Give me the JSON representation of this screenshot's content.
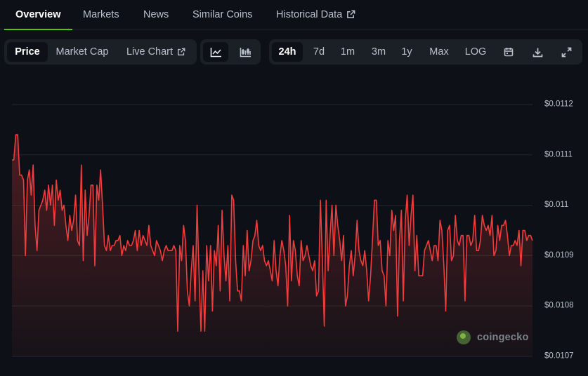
{
  "tabs": [
    {
      "label": "Overview",
      "active": true
    },
    {
      "label": "Markets"
    },
    {
      "label": "News"
    },
    {
      "label": "Similar Coins"
    },
    {
      "label": "Historical Data",
      "icon": "external-link-icon"
    }
  ],
  "metric_toggle": [
    {
      "label": "Price",
      "active": true
    },
    {
      "label": "Market Cap"
    },
    {
      "label": "Live Chart",
      "icon": "external-link-icon"
    }
  ],
  "chart_style": [
    {
      "icon": "line-chart-icon",
      "active": true
    },
    {
      "icon": "candlestick-chart-icon"
    }
  ],
  "ranges": [
    {
      "label": "24h",
      "active": true
    },
    {
      "label": "7d"
    },
    {
      "label": "1m"
    },
    {
      "label": "3m"
    },
    {
      "label": "1y"
    },
    {
      "label": "Max"
    },
    {
      "label": "LOG"
    }
  ],
  "tools": [
    "calendar-icon",
    "download-icon",
    "expand-icon"
  ],
  "watermark": "coingecko",
  "colors": {
    "line": "#f23c3c",
    "accent": "#4bcc00",
    "background": "#0d1117"
  },
  "chart_data": {
    "type": "area",
    "title": "",
    "xlabel": "",
    "ylabel": "",
    "ylim": [
      0.0107,
      0.0112
    ],
    "yticks": [
      {
        "value": 0.0112,
        "label": "$0.0112"
      },
      {
        "value": 0.0111,
        "label": "$0.0111"
      },
      {
        "value": 0.011,
        "label": "$0.011"
      },
      {
        "value": 0.0109,
        "label": "$0.0109"
      },
      {
        "value": 0.0108,
        "label": "$0.0108"
      },
      {
        "value": 0.0107,
        "label": "$0.0107"
      }
    ],
    "series": [
      {
        "values": [
          0.01109,
          0.01109,
          0.01114,
          0.01114,
          0.01106,
          0.01106,
          0.01105,
          0.0109,
          0.01105,
          0.01107,
          0.01102,
          0.01108,
          0.01096,
          0.01091,
          0.01099,
          0.011,
          0.01101,
          0.01103,
          0.01099,
          0.01104,
          0.011,
          0.01104,
          0.01096,
          0.01105,
          0.01101,
          0.01103,
          0.01099,
          0.011,
          0.01096,
          0.01093,
          0.01098,
          0.01095,
          0.01097,
          0.01102,
          0.01093,
          0.01092,
          0.01108,
          0.01089,
          0.01103,
          0.01094,
          0.01098,
          0.01104,
          0.01104,
          0.01088,
          0.01104,
          0.01101,
          0.01107,
          0.011,
          0.01092,
          0.01091,
          0.01094,
          0.01091,
          0.01092,
          0.01092,
          0.01093,
          0.01093,
          0.01094,
          0.0109,
          0.01092,
          0.01091,
          0.01093,
          0.01092,
          0.01092,
          0.01093,
          0.01095,
          0.01091,
          0.01095,
          0.01092,
          0.01094,
          0.01093,
          0.01092,
          0.01096,
          0.01092,
          0.01091,
          0.0109,
          0.01093,
          0.01092,
          0.01091,
          0.01089,
          0.01091,
          0.01092,
          0.01091,
          0.01091,
          0.01091,
          0.01092,
          0.01091,
          0.01075,
          0.01092,
          0.01089,
          0.01096,
          0.01093,
          0.01083,
          0.0108,
          0.01087,
          0.01092,
          0.01081,
          0.011,
          0.01087,
          0.01075,
          0.01087,
          0.01075,
          0.01092,
          0.01085,
          0.01092,
          0.01079,
          0.01091,
          0.01088,
          0.01096,
          0.01083,
          0.01099,
          0.0109,
          0.01085,
          0.01092,
          0.01081,
          0.01102,
          0.01101,
          0.01089,
          0.01083,
          0.01083,
          0.01081,
          0.01092,
          0.01086,
          0.01095,
          0.01087,
          0.01089,
          0.01093,
          0.01094,
          0.01097,
          0.01092,
          0.01091,
          0.01092,
          0.01089,
          0.01088,
          0.01089,
          0.01087,
          0.01085,
          0.01093,
          0.01087,
          0.01084,
          0.0109,
          0.01093,
          0.01091,
          0.01088,
          0.0108,
          0.01098,
          0.01085,
          0.01093,
          0.01091,
          0.01086,
          0.01084,
          0.01093,
          0.01089,
          0.0109,
          0.01092,
          0.0109,
          0.01088,
          0.01087,
          0.01089,
          0.01082,
          0.01083,
          0.01101,
          0.01089,
          0.01076,
          0.01101,
          0.01087,
          0.01094,
          0.011,
          0.0109,
          0.011,
          0.01096,
          0.01093,
          0.01089,
          0.01094,
          0.0108,
          0.01082,
          0.01088,
          0.01091,
          0.01086,
          0.0109,
          0.01097,
          0.01091,
          0.01089,
          0.01088,
          0.01091,
          0.01087,
          0.01081,
          0.01086,
          0.01093,
          0.01101,
          0.01101,
          0.01092,
          0.01093,
          0.01087,
          0.01086,
          0.0108,
          0.01093,
          0.0109,
          0.01099,
          0.01095,
          0.01098,
          0.01078,
          0.01093,
          0.01099,
          0.01081,
          0.01097,
          0.01102,
          0.01092,
          0.01098,
          0.01102,
          0.01087,
          0.01094,
          0.01086,
          0.01086,
          0.01086,
          0.01091,
          0.01092,
          0.01093,
          0.01091,
          0.01089,
          0.01092,
          0.01092,
          0.01089,
          0.01097,
          0.01095,
          0.01088,
          0.01079,
          0.01095,
          0.01096,
          0.01089,
          0.0109,
          0.01098,
          0.01093,
          0.01092,
          0.01094,
          0.01094,
          0.01081,
          0.01094,
          0.01094,
          0.01092,
          0.01093,
          0.01098,
          0.01091,
          0.01091,
          0.01093,
          0.01098,
          0.01096,
          0.01095,
          0.01096,
          0.01094,
          0.01098,
          0.0109,
          0.01091,
          0.01096,
          0.01093,
          0.01096,
          0.01096,
          0.01097,
          0.01094,
          0.0109,
          0.01092,
          0.01092,
          0.01093,
          0.01092,
          0.01095,
          0.01088,
          0.01095,
          0.01095,
          0.01093,
          0.01094,
          0.01094,
          0.01093
        ]
      }
    ]
  }
}
